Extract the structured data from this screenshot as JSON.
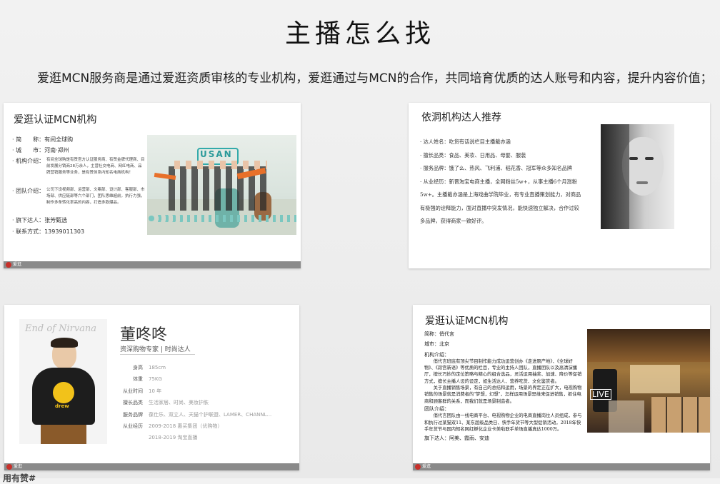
{
  "page": {
    "title": "主播怎么找",
    "subtitle": "爱逛MCN服务商是通过爱逛资质审核的专业机构，爱逛通过与MCN的合作，共同培育优质的达人账号和内容，提升内容价值；",
    "bottom_left_partial": "用有赞#"
  },
  "card1": {
    "title": "爱逛认证MCN机构",
    "rows": [
      {
        "label": "· 简　　称：",
        "value": "有间全球购"
      },
      {
        "label": "· 城　　市：",
        "value": "河南·郑州"
      },
      {
        "label": "· 机构介绍：",
        "value": "有间全球购是有赞官方认证服务商、有赞金牌代理商、目前发展分销商28万余人，主营社交电商、网红电商、品牌营销服务等业务，是有赞体系内知名电商机构！"
      },
      {
        "label": "· 团队介绍：",
        "value": "公司下设视频部、运营部、文案部、设计部、客服部、市场部、供应链部等六个部门，团队思维超前，执行力强，制作多条转化率高的内容，打造多款爆品。"
      },
      {
        "label": "· 旗下达人：",
        "value": "张芳甄选"
      },
      {
        "label": "· 联系方式：",
        "value": "13939011303"
      }
    ],
    "photo_sign": "USAN",
    "footer": "爱逛"
  },
  "card2": {
    "title": "依洞机构达人推荐",
    "lines": [
      "· 达人姓名：吃货有话说栏目主播戴亦涵",
      "· 擅长品类：食品、美妆、日用品、母婴、服装",
      "· 服务品牌：饿了么、热风、飞利浦、稻花香、冠军等众多知名品牌",
      "· 从业经历：新晋淘宝电商主播，全网粉丝5w+，从事主播6个月涨粉",
      "5w+。主播戴亦涵是上海戏曲学院毕业，有专业直播策划能力，对商品",
      "有极强的诠释能力，面对直播中突发情况，能快速独立解决，合作过较",
      "多品牌，获得商家一致好评。"
    ]
  },
  "card3": {
    "name": "董咚咚",
    "tagline": "资深购物专家 | 时尚达人",
    "photo_caption": "End of Nirvana",
    "hoodie_text": "drew",
    "rows": [
      {
        "label": "身高",
        "value": "185cm"
      },
      {
        "label": "体重",
        "value": "75KG"
      },
      {
        "label": "从业时间",
        "value": "10 年"
      },
      {
        "label": "擅长品类",
        "value": "生活家居、时尚、美妆护肤"
      },
      {
        "label": "服务品牌",
        "value": "葆仕乐、双立人、天猫个护联盟、LAMER、CHANNL..."
      },
      {
        "label": "从业经历",
        "value": "2009-2018 惠买集团（优购物）"
      },
      {
        "label": "",
        "value": "2018-2019 淘宝直播"
      }
    ],
    "footer": "爱逛"
  },
  "card4": {
    "title": "爱逛认证MCN机构",
    "lines": [
      "简称：俏代言",
      "城市：北京",
      "机构介绍：",
      "　　俏代言班底有顶尖节目制作能力成功运营创办《走进原产地》、《全球好物》、《寂宫新语》等优质的栏目，专业的主持人团队，直播团队以及高清演播厅，擅长巧妙的定位策略与精心的组合选品，灵活运用抽奖、加速、降价等促销方式，擅长主播人设的设定，如生活达人、营养吃货、文化鉴赏者。",
      "　　关于直播销售场景，有自己的总结和运用，场景的界定正在扩大，电视购物销售的场景就是消费者的\"梦想，幻想\"，怎样运用场景思维来促进销售，抓住电商和顾客群的关系，而我们就是场景制造者。",
      "团队介绍：",
      "　　俏代言团队由一线电商平台、电视购物企业的电商直播岗位人员组成，参与和执行过某猫双11、某东超级品类日、快手年货节等大型促销活动，2018年快手年货节与国内知名网红孵化企业卡美啦联手单场直播真达1000万。",
      "旗下达人：阿美、霞雨、安迪"
    ],
    "photo_sign": "LIVE",
    "footer": "爱逛"
  },
  "colors": {
    "brand_red": "#c8302a",
    "footer_gray": "#8a8a8a",
    "orange_sign": "#e8702a"
  }
}
